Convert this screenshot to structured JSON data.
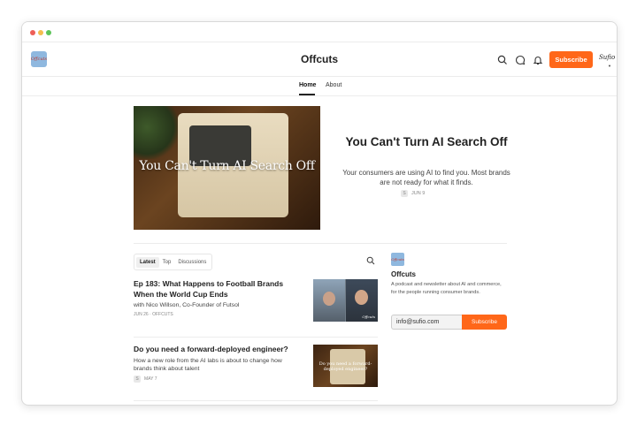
{
  "window": {
    "controls": [
      "close",
      "minimize",
      "maximize"
    ]
  },
  "header": {
    "logo_text": "Offcuts",
    "title": "Offcuts",
    "subscribe_label": "Subscribe",
    "avatar_text": "Sufio",
    "icons": [
      "search-icon",
      "chat-icon",
      "bell-icon"
    ]
  },
  "nav": {
    "tabs": [
      {
        "label": "Home",
        "active": true
      },
      {
        "label": "About",
        "active": false
      }
    ]
  },
  "featured": {
    "image_caption": "You Can't Turn AI Search Off",
    "title": "You Can't Turn AI Search Off",
    "subtitle": "Your consumers are using AI to find you. Most brands are not ready for what it finds.",
    "date": "JUN 9"
  },
  "list": {
    "tabs": [
      "Latest",
      "Top",
      "Discussions"
    ],
    "active_tab": "Latest",
    "posts": [
      {
        "title": "Ep 183: What Happens to Football Brands When the World Cup Ends",
        "subtitle": "with Nico Willson, Co-Founder of Futsol",
        "meta": "JUN 26 · OFFCUTS",
        "thumb_tag": "Offcuts"
      },
      {
        "title": "Do you need a forward-deployed engineer?",
        "subtitle": "How a new role from the AI labs is about to change how brands think about talent",
        "meta": "MAY 7",
        "thumb_caption": "Do you need a forward-deployed engineer?"
      }
    ]
  },
  "sidebar": {
    "logo_text": "Offcuts",
    "name": "Offcuts",
    "description": "A podcast and newsletter about AI and commerce, for the people running consumer brands.",
    "email_value": "info@sufio.com",
    "subscribe_label": "Subscribe"
  },
  "colors": {
    "accent": "#ff6719",
    "logo_bg": "#8fb8df"
  }
}
